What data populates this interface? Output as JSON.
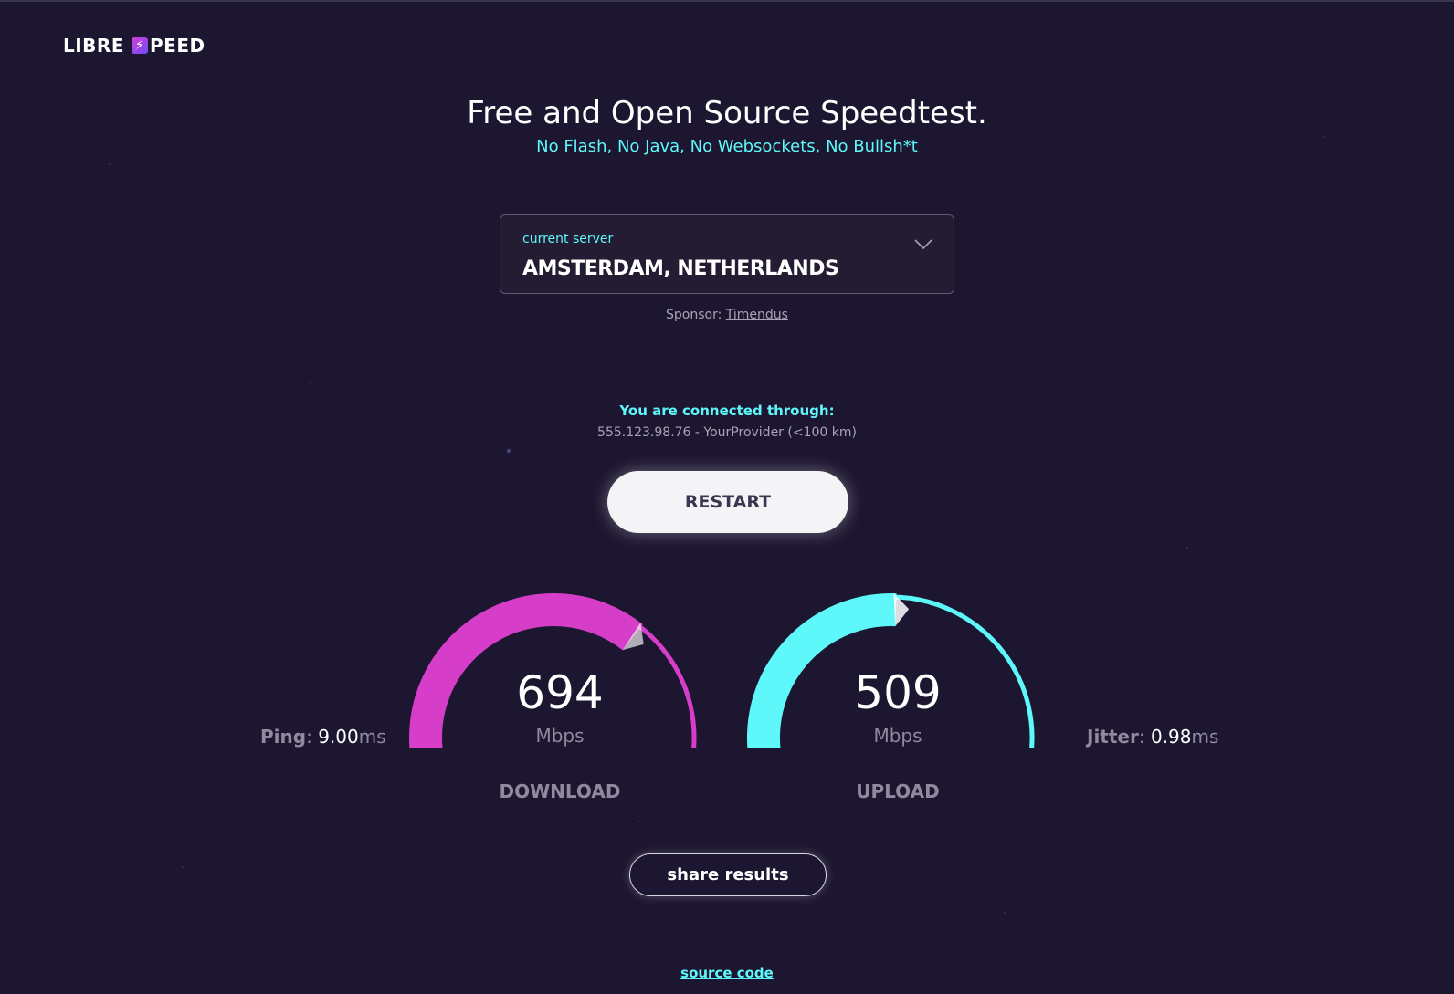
{
  "header": {
    "logo_left": "LIBRE",
    "logo_right": "PEED"
  },
  "hero": {
    "title": "Free and Open Source Speedtest.",
    "subtitle": "No Flash, No Java, No Websockets, No Bullsh*t"
  },
  "server": {
    "label": "current server",
    "value": "AMSTERDAM, NETHERLANDS",
    "sponsor_label": "Sponsor:",
    "sponsor_name": "Timendus"
  },
  "connection": {
    "label": "You are connected through:",
    "value": "555.123.98.76 - YourProvider (<100 km)"
  },
  "actions": {
    "restart": "RESTART",
    "share": "share results"
  },
  "download": {
    "value": "694",
    "unit": "Mbps",
    "caption": "DOWNLOAD",
    "color": "#d63ec9",
    "level": 0.69
  },
  "upload": {
    "value": "509",
    "unit": "Mbps",
    "caption": "UPLOAD",
    "color": "#5ef8fb",
    "level": 0.51
  },
  "ping": {
    "label": "Ping",
    "value": "9.00",
    "unit": "ms"
  },
  "jitter": {
    "label": "Jitter",
    "value": "0.98",
    "unit": "ms"
  },
  "footer": {
    "source": "source code"
  },
  "icons": [
    "bolt-icon",
    "chevron-down-icon"
  ]
}
